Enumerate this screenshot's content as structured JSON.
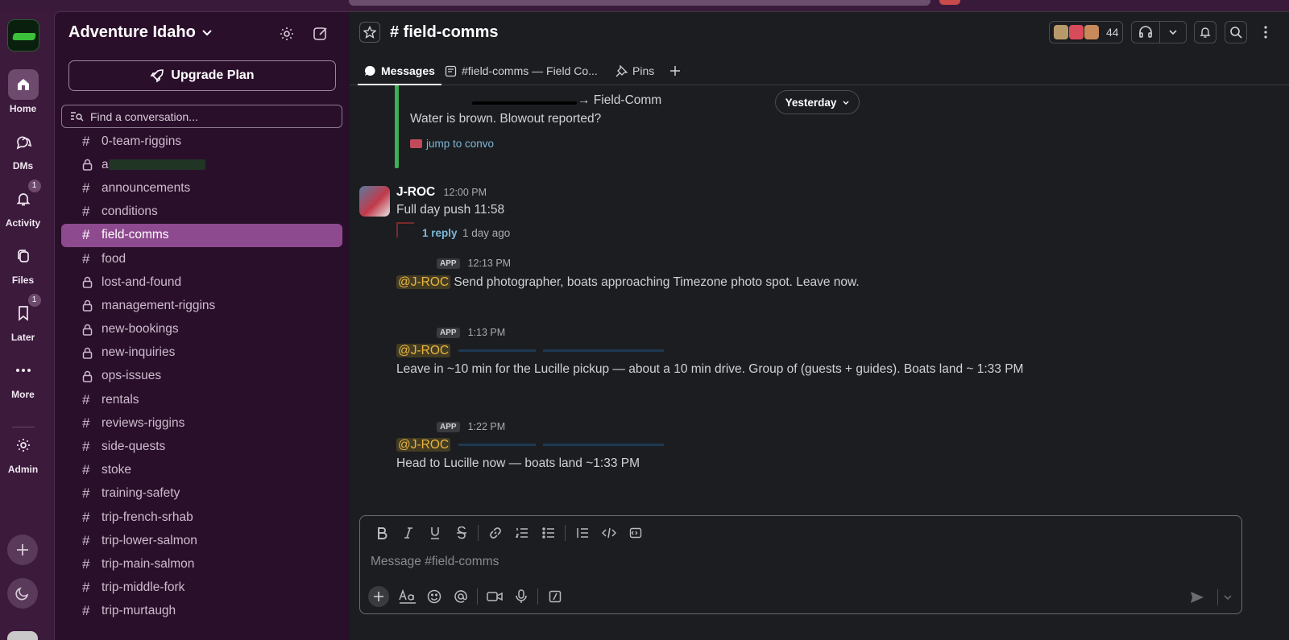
{
  "workspace": {
    "name": "Adventure Idaho"
  },
  "rail": {
    "items": [
      {
        "label": "Home",
        "badge": ""
      },
      {
        "label": "DMs",
        "badge": ""
      },
      {
        "label": "Activity",
        "badge": "1"
      },
      {
        "label": "Files",
        "badge": ""
      },
      {
        "label": "Later",
        "badge": "1"
      },
      {
        "label": "More",
        "badge": ""
      },
      {
        "label": "Admin",
        "badge": ""
      }
    ]
  },
  "sidebar": {
    "upgrade_label": "Upgrade Plan",
    "search_placeholder": "Find a conversation...",
    "channels": [
      {
        "name": "0-team-riggins",
        "type": "public"
      },
      {
        "name": "a",
        "type": "private",
        "redacted": true
      },
      {
        "name": "announcements",
        "type": "public"
      },
      {
        "name": "conditions",
        "type": "public"
      },
      {
        "name": "field-comms",
        "type": "public",
        "active": true
      },
      {
        "name": "food",
        "type": "public"
      },
      {
        "name": "lost-and-found",
        "type": "private"
      },
      {
        "name": "management-riggins",
        "type": "private"
      },
      {
        "name": "new-bookings",
        "type": "private"
      },
      {
        "name": "new-inquiries",
        "type": "private"
      },
      {
        "name": "ops-issues",
        "type": "private"
      },
      {
        "name": "rentals",
        "type": "public"
      },
      {
        "name": "reviews-riggins",
        "type": "public"
      },
      {
        "name": "side-quests",
        "type": "public"
      },
      {
        "name": "stoke",
        "type": "public"
      },
      {
        "name": "training-safety",
        "type": "public"
      },
      {
        "name": "trip-french-srhab",
        "type": "public"
      },
      {
        "name": "trip-lower-salmon",
        "type": "public"
      },
      {
        "name": "trip-main-salmon",
        "type": "public"
      },
      {
        "name": "trip-middle-fork",
        "type": "public"
      },
      {
        "name": "trip-murtaugh",
        "type": "public"
      }
    ]
  },
  "channel": {
    "title": "# field-comms",
    "member_count": "44",
    "tabs": [
      {
        "label": "Messages"
      },
      {
        "label": "#field-comms — Field Co..."
      },
      {
        "label": "Pins"
      }
    ]
  },
  "messages": {
    "quoted": {
      "arrow_text": "→ Field-Comm",
      "text": "Water is brown. Blowout reported?",
      "link": "jump to convo"
    },
    "date_divider": "Yesterday",
    "main": {
      "author": "J-ROC",
      "time": "12:00 PM",
      "text": "Full day push 11:58",
      "reply_count": "1 reply",
      "reply_age": "1 day ago"
    },
    "app_messages": [
      {
        "badge": "APP",
        "time": "12:13 PM",
        "mention": "@J-ROC",
        "text": "Send photographer, boats approaching Timezone photo spot. Leave now."
      },
      {
        "badge": "APP",
        "time": "1:13 PM",
        "mention": "@J-ROC",
        "text": "Leave in ~10 min for the Lucille pickup — about a 10 min drive.  Group of (guests + guides). Boats land ~ 1:33 PM"
      },
      {
        "badge": "APP",
        "time": "1:22 PM",
        "mention": "@J-ROC",
        "text": "Head to Lucille now — boats land ~1:33 PM"
      }
    ]
  },
  "composer": {
    "placeholder": "Message #field-comms"
  },
  "colors": {
    "aubergine": "#3b1a3c",
    "sidebar_bg": "#2a0f2b",
    "active_channel": "#8e4a8f",
    "main_bg": "#1b1d21",
    "mention": "#e8b53f",
    "link": "#7db9d8",
    "quote_bar": "#3fae55"
  }
}
